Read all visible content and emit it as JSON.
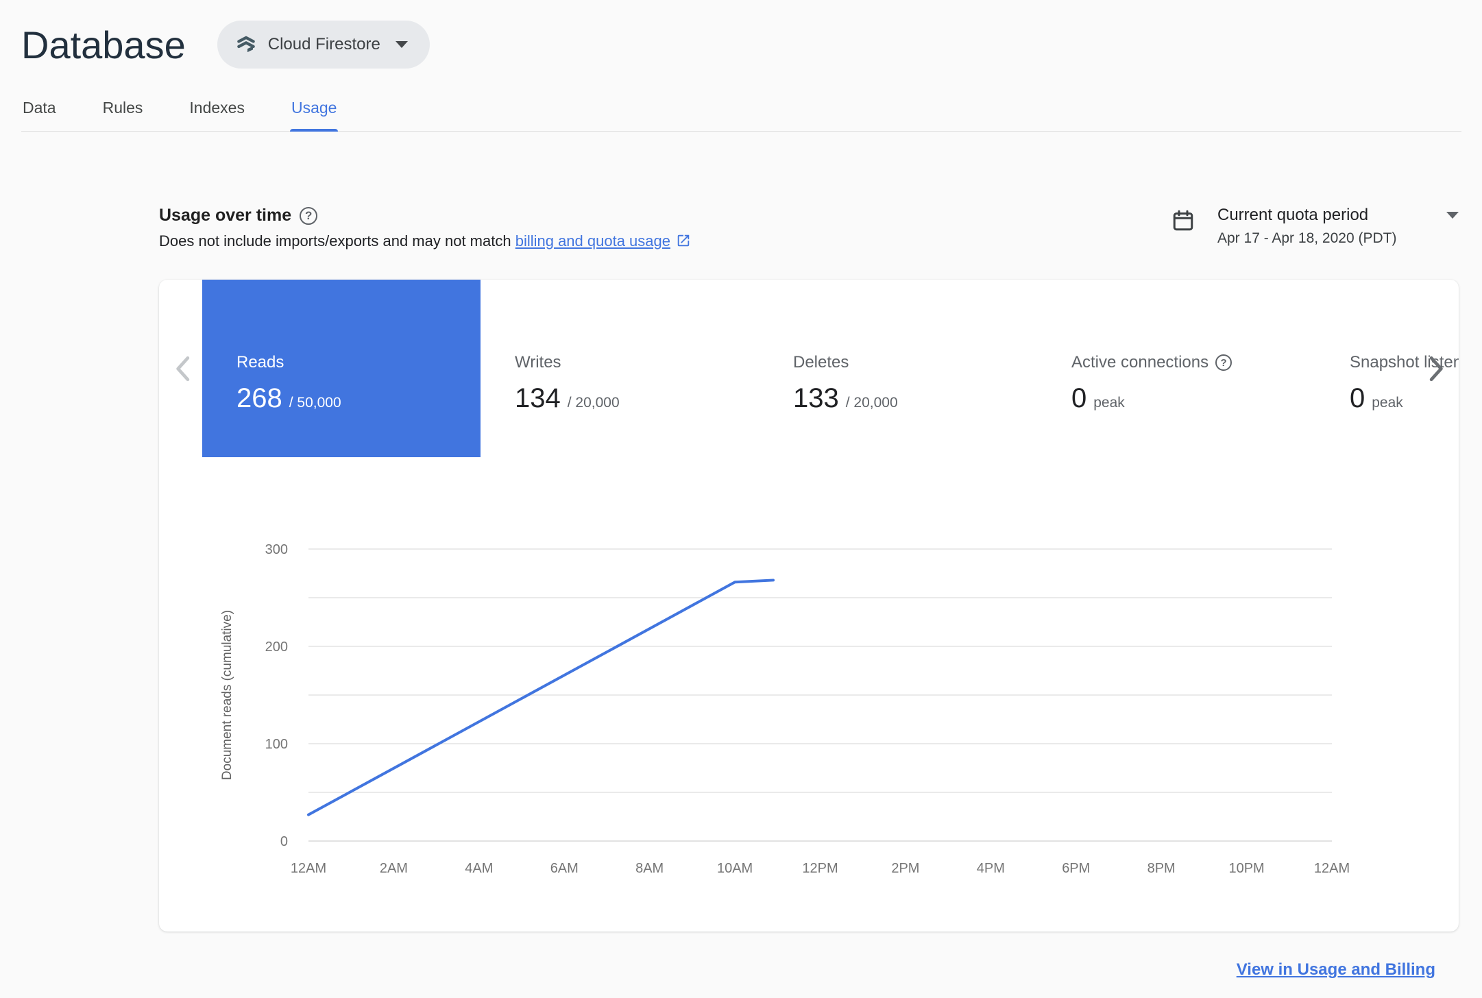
{
  "header": {
    "title": "Database",
    "product_selector": {
      "label": "Cloud Firestore"
    }
  },
  "tabs": [
    {
      "label": "Data",
      "active": false
    },
    {
      "label": "Rules",
      "active": false
    },
    {
      "label": "Indexes",
      "active": false
    },
    {
      "label": "Usage",
      "active": true
    }
  ],
  "usage_section": {
    "title": "Usage over time",
    "help_glyph": "?",
    "subtitle_prefix": "Does not include imports/exports and may not match ",
    "subtitle_link_text": "billing and quota usage",
    "quota_selector": {
      "label": "Current quota period",
      "date_range": "Apr 17 - Apr 18, 2020 (PDT)"
    }
  },
  "metrics": {
    "items": [
      {
        "label": "Reads",
        "value": "268",
        "quota": "/ 50,000",
        "selected": true
      },
      {
        "label": "Writes",
        "value": "134",
        "quota": "/ 20,000",
        "selected": false
      },
      {
        "label": "Deletes",
        "value": "133",
        "quota": "/ 20,000",
        "selected": false
      },
      {
        "label": "Active connections",
        "value": "0",
        "quota": "peak",
        "selected": false,
        "help_glyph": "?"
      },
      {
        "label": "Snapshot listeners",
        "value": "0",
        "quota": "peak",
        "selected": false
      }
    ]
  },
  "chart_data": {
    "type": "line",
    "title": "",
    "xlabel": "",
    "ylabel": "Document reads (cumulative)",
    "ylim": [
      0,
      300
    ],
    "y_gridline_step": 50,
    "y_label_step": 100,
    "x_hours_range": [
      0,
      24
    ],
    "x_tick_labels": [
      "12AM",
      "2AM",
      "4AM",
      "6AM",
      "8AM",
      "10AM",
      "12PM",
      "2PM",
      "4PM",
      "6PM",
      "8PM",
      "10PM",
      "12AM"
    ],
    "grid": true,
    "legend": "none",
    "series": [
      {
        "name": "Document reads (cumulative)",
        "points": [
          [
            0,
            27
          ],
          [
            10,
            266
          ],
          [
            10.9,
            268
          ]
        ]
      }
    ]
  },
  "footer": {
    "link_text": "View in Usage and Billing"
  },
  "colors": {
    "accent_blue": "#4175DF",
    "selected_tile_bg": "#4175DF",
    "chart_line": "#4175DF",
    "gridline": "#e3e3e3",
    "tick_label": "#757575",
    "page_bg": "#fafafa"
  }
}
